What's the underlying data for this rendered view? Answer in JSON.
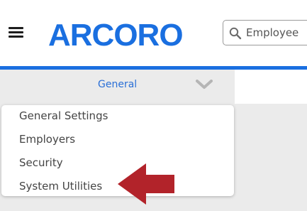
{
  "header": {
    "logo_text": "ARCORO",
    "search": {
      "placeholder": "Employee",
      "value": ""
    },
    "menu_icon": "hamburger-icon",
    "brand_color": "#1a6fe0"
  },
  "subnav": {
    "selected_label": "General",
    "chevron_icon": "chevron-down-icon"
  },
  "dropdown": {
    "items": [
      {
        "label": "General Settings"
      },
      {
        "label": "Employers"
      },
      {
        "label": "Security"
      },
      {
        "label": "System Utilities"
      }
    ]
  },
  "annotation": {
    "arrow_icon": "arrow-left-icon",
    "arrow_color": "#b2232a",
    "points_to": "System Utilities"
  }
}
